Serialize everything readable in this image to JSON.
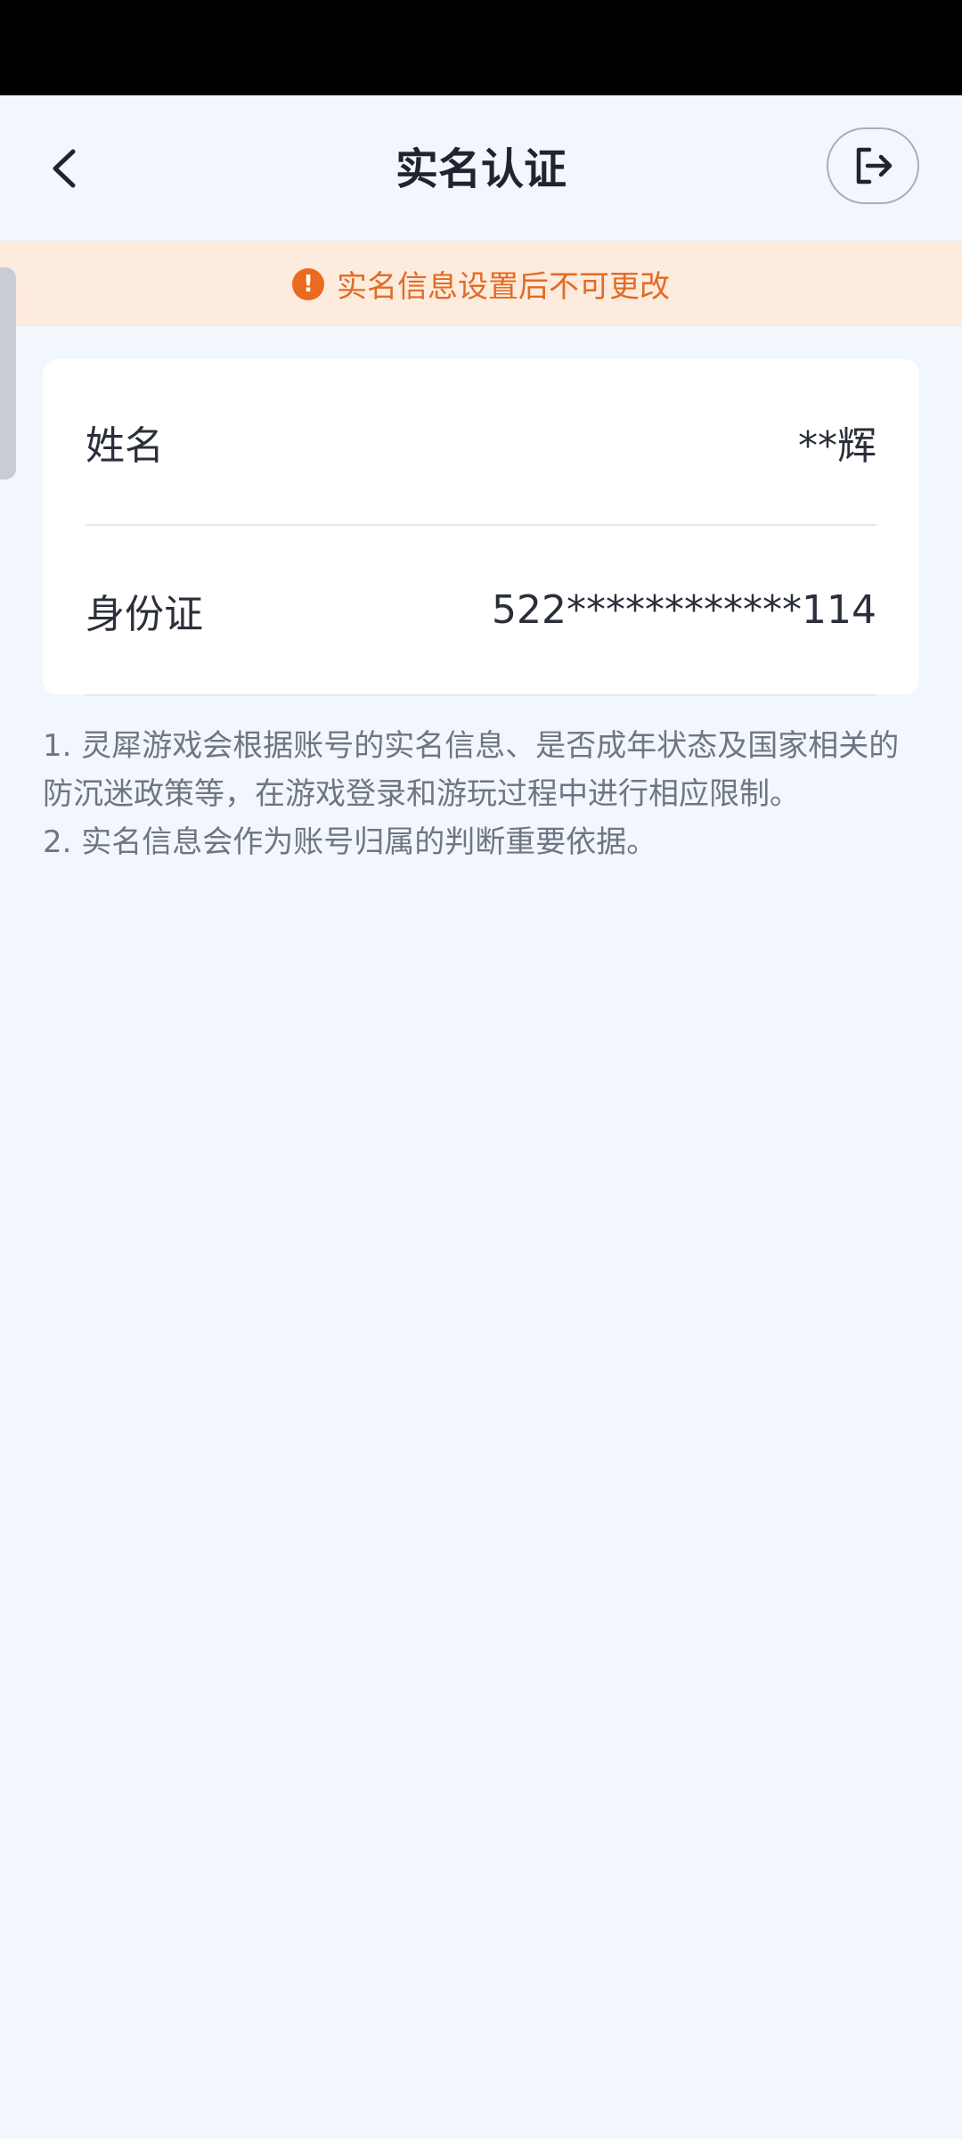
{
  "header": {
    "title": "实名认证",
    "back_icon": "chevron-left-icon",
    "logout_icon": "logout-icon"
  },
  "notice": {
    "icon": "exclamation-icon",
    "icon_glyph": "!",
    "text": "实名信息设置后不可更改",
    "color": "#e26b25"
  },
  "form": {
    "rows": [
      {
        "label": "姓名",
        "value": "**辉"
      },
      {
        "label": "身份证",
        "value": "522************114"
      }
    ]
  },
  "notes": [
    "1. 灵犀游戏会根据账号的实名信息、是否成年状态及国家相关的防沉迷政策等，在游戏登录和游玩过程中进行相应限制。",
    "2. 实名信息会作为账号归属的判断重要依据。"
  ]
}
